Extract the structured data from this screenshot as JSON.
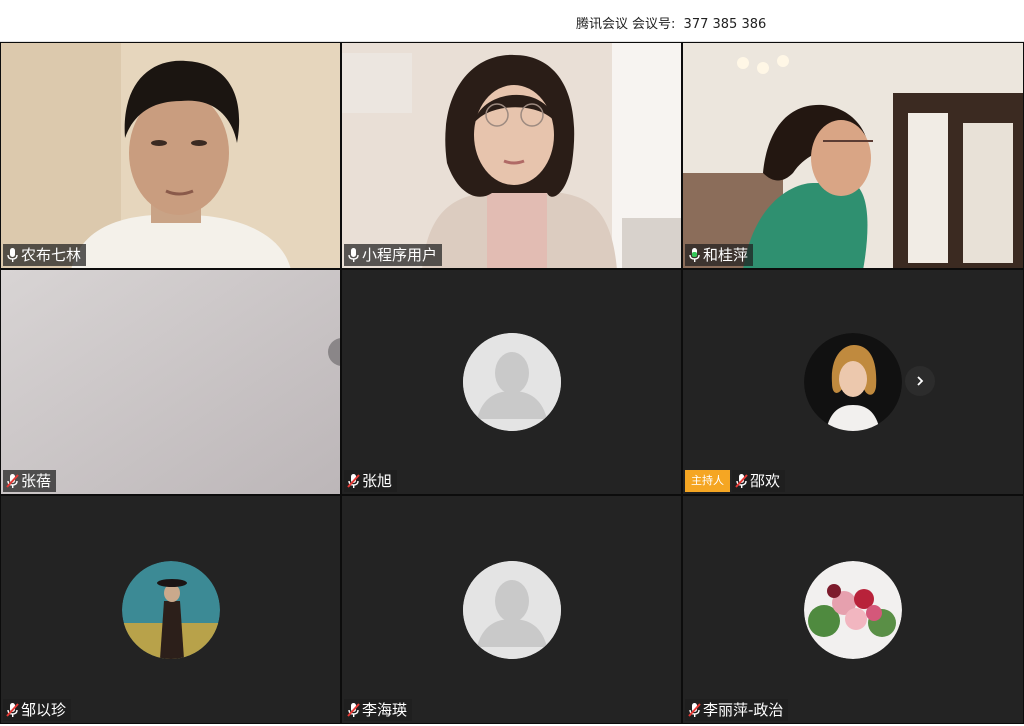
{
  "window": {
    "app_name": "腾讯会议",
    "meeting_id_label": "会议号:",
    "meeting_id": "377 385 386"
  },
  "host_badge": "主持人",
  "participants": [
    {
      "name": "农布七林",
      "mic": "on",
      "video": "camera"
    },
    {
      "name": "小程序用户",
      "mic": "on",
      "video": "camera"
    },
    {
      "name": "和桂萍",
      "mic": "speaking",
      "video": "camera"
    },
    {
      "name": "张蓓",
      "mic": "muted",
      "video": "camera"
    },
    {
      "name": "张旭",
      "mic": "muted",
      "video": "default-avatar"
    },
    {
      "name": "邵欢",
      "mic": "muted",
      "video": "photo-avatar",
      "host": true
    },
    {
      "name": "邹以珍",
      "mic": "muted",
      "video": "painting-avatar"
    },
    {
      "name": "李海瑛",
      "mic": "muted",
      "video": "default-avatar"
    },
    {
      "name": "李丽萍-政治",
      "mic": "muted",
      "video": "flower-avatar"
    }
  ],
  "colors": {
    "tile_bg": "#232323",
    "host_badge": "#f5a623",
    "mic_speaking": "#34c759",
    "mic_muted": "#e53935"
  },
  "icons": {
    "mic": "microphone-icon",
    "muted": "microphone-muted-icon",
    "next": "chevron-right-icon"
  }
}
